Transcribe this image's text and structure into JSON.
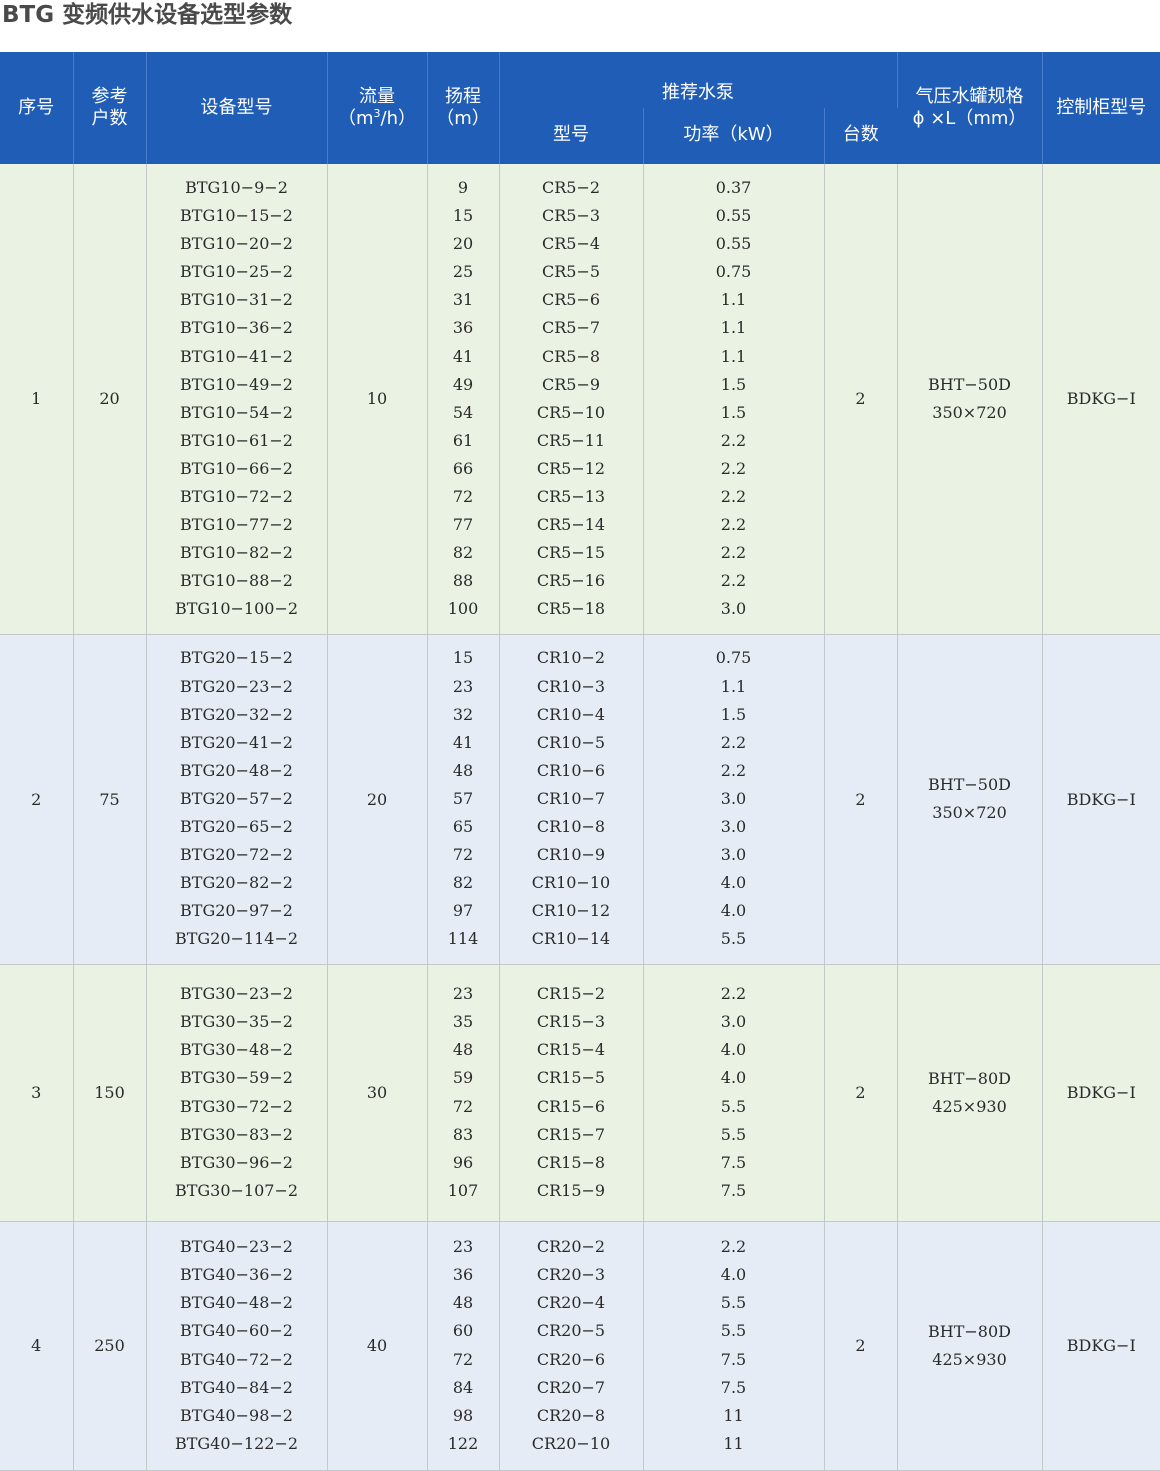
{
  "title": "BTG 变频供水设备选型参数",
  "headers": {
    "index": "序号",
    "households_line1": "参考",
    "households_line2": "户数",
    "model": "设备型号",
    "flow_line1": "流量",
    "flow_line2_pre": "（m",
    "flow_line2_sup": "3",
    "flow_line2_post": "/h）",
    "head_line1": "扬程",
    "head_line2": "（m）",
    "pump_group": "推荐水泵",
    "pump_model": "型号",
    "pump_power": "功率（kW）",
    "pump_count": "台数",
    "tank_line1": "气压水罐规格",
    "tank_line2": "ϕ ×L（mm）",
    "cabinet": "控制柜型号"
  },
  "groups": [
    {
      "index": "1",
      "households": "20",
      "flow": "10",
      "count": "2",
      "tank_model": "BHT−50D",
      "tank_size": "350×720",
      "cabinet": "BDKG−I",
      "models": [
        "BTG10−9−2",
        "BTG10−15−2",
        "BTG10−20−2",
        "BTG10−25−2",
        "BTG10−31−2",
        "BTG10−36−2",
        "BTG10−41−2",
        "BTG10−49−2",
        "BTG10−54−2",
        "BTG10−61−2",
        "BTG10−66−2",
        "BTG10−72−2",
        "BTG10−77−2",
        "BTG10−82−2",
        "BTG10−88−2",
        "BTG10−100−2"
      ],
      "heads": [
        "9",
        "15",
        "20",
        "25",
        "31",
        "36",
        "41",
        "49",
        "54",
        "61",
        "66",
        "72",
        "77",
        "82",
        "88",
        "100"
      ],
      "pumps": [
        "CR5−2",
        "CR5−3",
        "CR5−4",
        "CR5−5",
        "CR5−6",
        "CR5−7",
        "CR5−8",
        "CR5−9",
        "CR5−10",
        "CR5−11",
        "CR5−12",
        "CR5−13",
        "CR5−14",
        "CR5−15",
        "CR5−16",
        "CR5−18"
      ],
      "powers": [
        "0.37",
        "0.55",
        "0.55",
        "0.75",
        "1.1",
        "1.1",
        "1.1",
        "1.5",
        "1.5",
        "2.2",
        "2.2",
        "2.2",
        "2.2",
        "2.2",
        "2.2",
        "3.0"
      ]
    },
    {
      "index": "2",
      "households": "75",
      "flow": "20",
      "count": "2",
      "tank_model": "BHT−50D",
      "tank_size": "350×720",
      "cabinet": "BDKG−I",
      "models": [
        "BTG20−15−2",
        "BTG20−23−2",
        "BTG20−32−2",
        "BTG20−41−2",
        "BTG20−48−2",
        "BTG20−57−2",
        "BTG20−65−2",
        "BTG20−72−2",
        "BTG20−82−2",
        "BTG20−97−2",
        "BTG20−114−2"
      ],
      "heads": [
        "15",
        "23",
        "32",
        "41",
        "48",
        "57",
        "65",
        "72",
        "82",
        "97",
        "114"
      ],
      "pumps": [
        "CR10−2",
        "CR10−3",
        "CR10−4",
        "CR10−5",
        "CR10−6",
        "CR10−7",
        "CR10−8",
        "CR10−9",
        "CR10−10",
        "CR10−12",
        "CR10−14"
      ],
      "powers": [
        "0.75",
        "1.1",
        "1.5",
        "2.2",
        "2.2",
        "3.0",
        "3.0",
        "3.0",
        "4.0",
        "4.0",
        "5.5"
      ]
    },
    {
      "index": "3",
      "households": "150",
      "flow": "30",
      "count": "2",
      "tank_model": "BHT−80D",
      "tank_size": "425×930",
      "cabinet": "BDKG−I",
      "models": [
        "BTG30−23−2",
        "BTG30−35−2",
        "BTG30−48−2",
        "BTG30−59−2",
        "BTG30−72−2",
        "BTG30−83−2",
        "BTG30−96−2",
        "BTG30−107−2"
      ],
      "heads": [
        "23",
        "35",
        "48",
        "59",
        "72",
        "83",
        "96",
        "107"
      ],
      "pumps": [
        "CR15−2",
        "CR15−3",
        "CR15−4",
        "CR15−5",
        "CR15−6",
        "CR15−7",
        "CR15−8",
        "CR15−9"
      ],
      "powers": [
        "2.2",
        "3.0",
        "4.0",
        "4.0",
        "5.5",
        "5.5",
        "7.5",
        "7.5"
      ]
    },
    {
      "index": "4",
      "households": "250",
      "flow": "40",
      "count": "2",
      "tank_model": "BHT−80D",
      "tank_size": "425×930",
      "cabinet": "BDKG−I",
      "models": [
        "BTG40−23−2",
        "BTG40−36−2",
        "BTG40−48−2",
        "BTG40−60−2",
        "BTG40−72−2",
        "BTG40−84−2",
        "BTG40−98−2",
        "BTG40−122−2"
      ],
      "heads": [
        "23",
        "36",
        "48",
        "60",
        "72",
        "84",
        "98",
        "122"
      ],
      "pumps": [
        "CR20−2",
        "CR20−3",
        "CR20−4",
        "CR20−5",
        "CR20−6",
        "CR20−7",
        "CR20−8",
        "CR20−10"
      ],
      "powers": [
        "2.2",
        "4.0",
        "5.5",
        "5.5",
        "7.5",
        "7.5",
        "11",
        "11"
      ]
    }
  ],
  "colors": {
    "header_bg": "#1f5db6",
    "row_green": "#eaf2e3",
    "row_blue": "#e6ecf6",
    "title_text": "#4a4a4a"
  }
}
